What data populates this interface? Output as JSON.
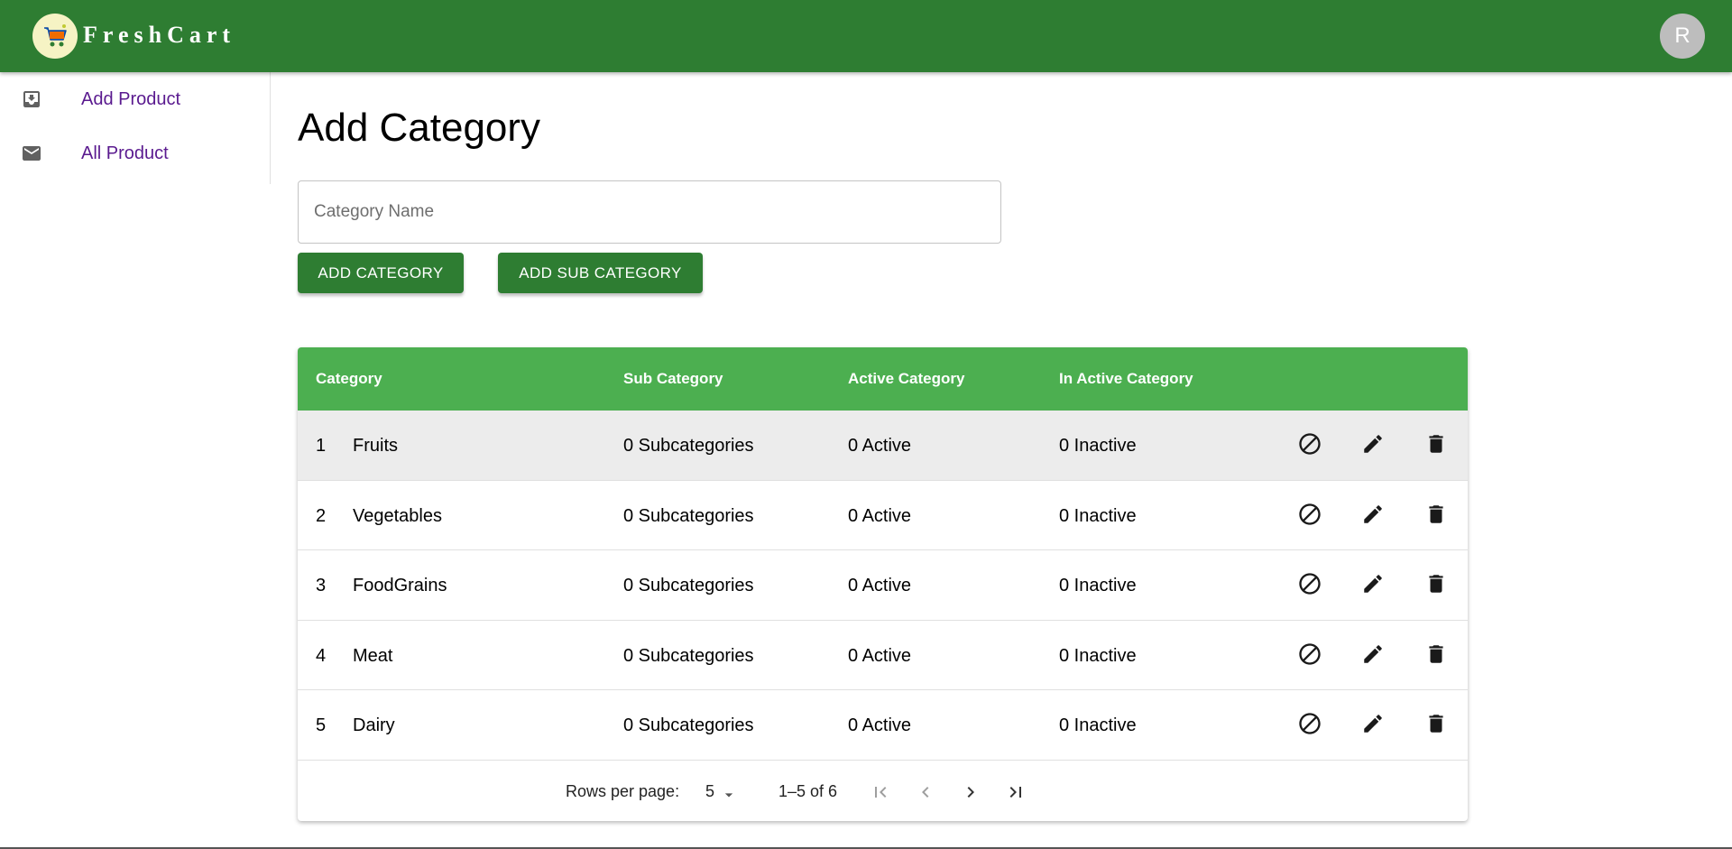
{
  "app": {
    "brand": "FreshCart",
    "avatar_initial": "R",
    "brand_color": "#2e7d32",
    "header_color": "#4caf50"
  },
  "sidebar": {
    "items": [
      {
        "label": "Add Product",
        "icon": "move-to-inbox-icon"
      },
      {
        "label": "All Product",
        "icon": "mail-icon"
      }
    ]
  },
  "main": {
    "title": "Add Category",
    "category_input": {
      "placeholder": "Category Name",
      "value": ""
    },
    "add_category_label": "ADD CATEGORY",
    "add_sub_category_label": "ADD SUB CATEGORY"
  },
  "table": {
    "columns": [
      "Category",
      "Sub Category",
      "Active Category",
      "In Active Category"
    ],
    "rows": [
      {
        "index": "1",
        "name": "Fruits",
        "sub": "0 Subcategories",
        "active": "0 Active",
        "inactive": "0 Inactive"
      },
      {
        "index": "2",
        "name": "Vegetables",
        "sub": "0 Subcategories",
        "active": "0 Active",
        "inactive": "0 Inactive"
      },
      {
        "index": "3",
        "name": "FoodGrains",
        "sub": "0 Subcategories",
        "active": "0 Active",
        "inactive": "0 Inactive"
      },
      {
        "index": "4",
        "name": "Meat",
        "sub": "0 Subcategories",
        "active": "0 Active",
        "inactive": "0 Inactive"
      },
      {
        "index": "5",
        "name": "Dairy",
        "sub": "0 Subcategories",
        "active": "0 Active",
        "inactive": "0 Inactive"
      }
    ],
    "row_actions": [
      "block-icon",
      "edit-icon",
      "delete-icon"
    ]
  },
  "pagination": {
    "rows_per_page_label": "Rows per page:",
    "rows_per_page_value": "5",
    "range_label": "1–5 of 6"
  }
}
